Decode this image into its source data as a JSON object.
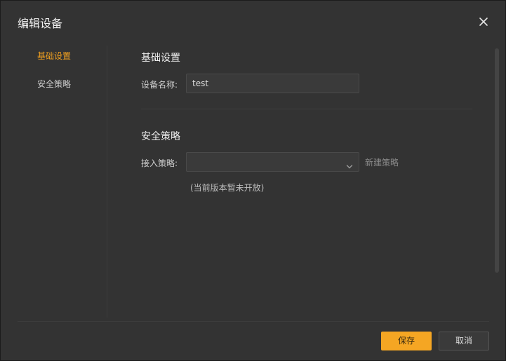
{
  "dialog": {
    "title": "编辑设备"
  },
  "sidebar": {
    "items": [
      {
        "label": "基础设置"
      },
      {
        "label": "安全策略"
      }
    ]
  },
  "basic": {
    "section_title": "基础设置",
    "device_name_label": "设备名称:",
    "device_name_value": "test"
  },
  "security": {
    "section_title": "安全策略",
    "access_policy_label": "接入策略:",
    "access_policy_value": "",
    "new_policy_link": "新建策略",
    "note": "(当前版本暂未开放)"
  },
  "footer": {
    "save_label": "保存",
    "cancel_label": "取消"
  },
  "colors": {
    "accent": "#f5a623",
    "active_nav": "#f0a020",
    "dialog_bg": "#333333"
  },
  "icons": {
    "close": "close-icon",
    "dropdown": "chevron-down-icon"
  }
}
